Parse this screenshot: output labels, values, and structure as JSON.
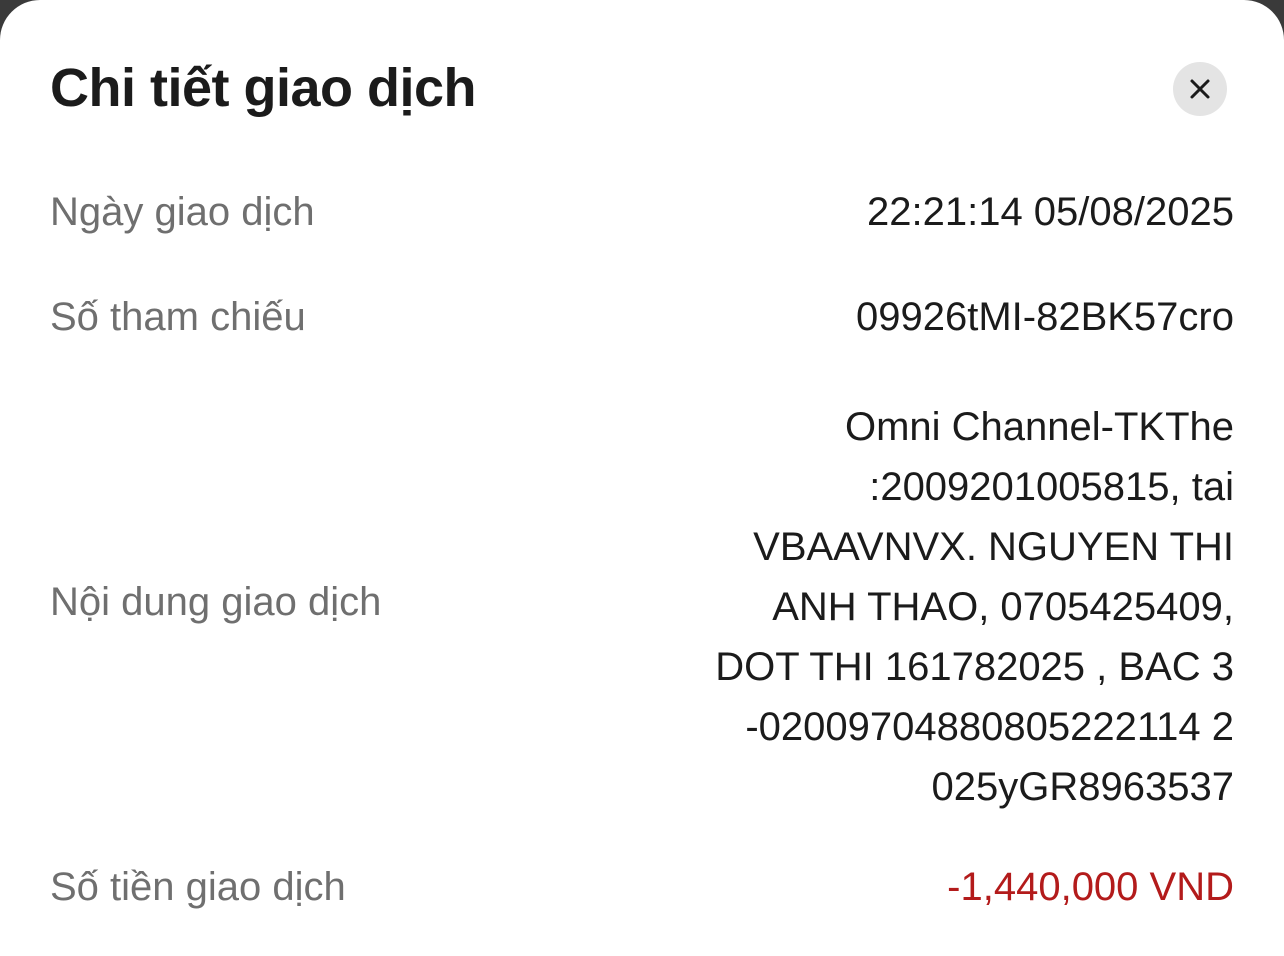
{
  "header": {
    "title": "Chi tiết giao dịch",
    "close_icon": "close-icon"
  },
  "rows": {
    "date": {
      "label": "Ngày giao dịch",
      "value": "22:21:14 05/08/2025"
    },
    "reference": {
      "label": "Số tham chiếu",
      "value": "09926tMI-82BK57cro"
    },
    "content": {
      "label": "Nội dung giao dịch",
      "lines": [
        "Omni Channel-TKThe",
        ":2009201005815, tai",
        "VBAAVNVX. NGUYEN THI",
        "ANH THAO, 0705425409,",
        "DOT THI 161782025 , BAC 3",
        "-02009704880805222114 2",
        "025yGR8963537"
      ]
    },
    "amount": {
      "label": "Số tiền giao dịch",
      "value": "-1,440,000 VND"
    }
  },
  "colors": {
    "amount_negative": "#b31b1b",
    "label": "#6f6f6f",
    "value": "#1b1b1b",
    "close_bg": "#e4e4e4"
  }
}
